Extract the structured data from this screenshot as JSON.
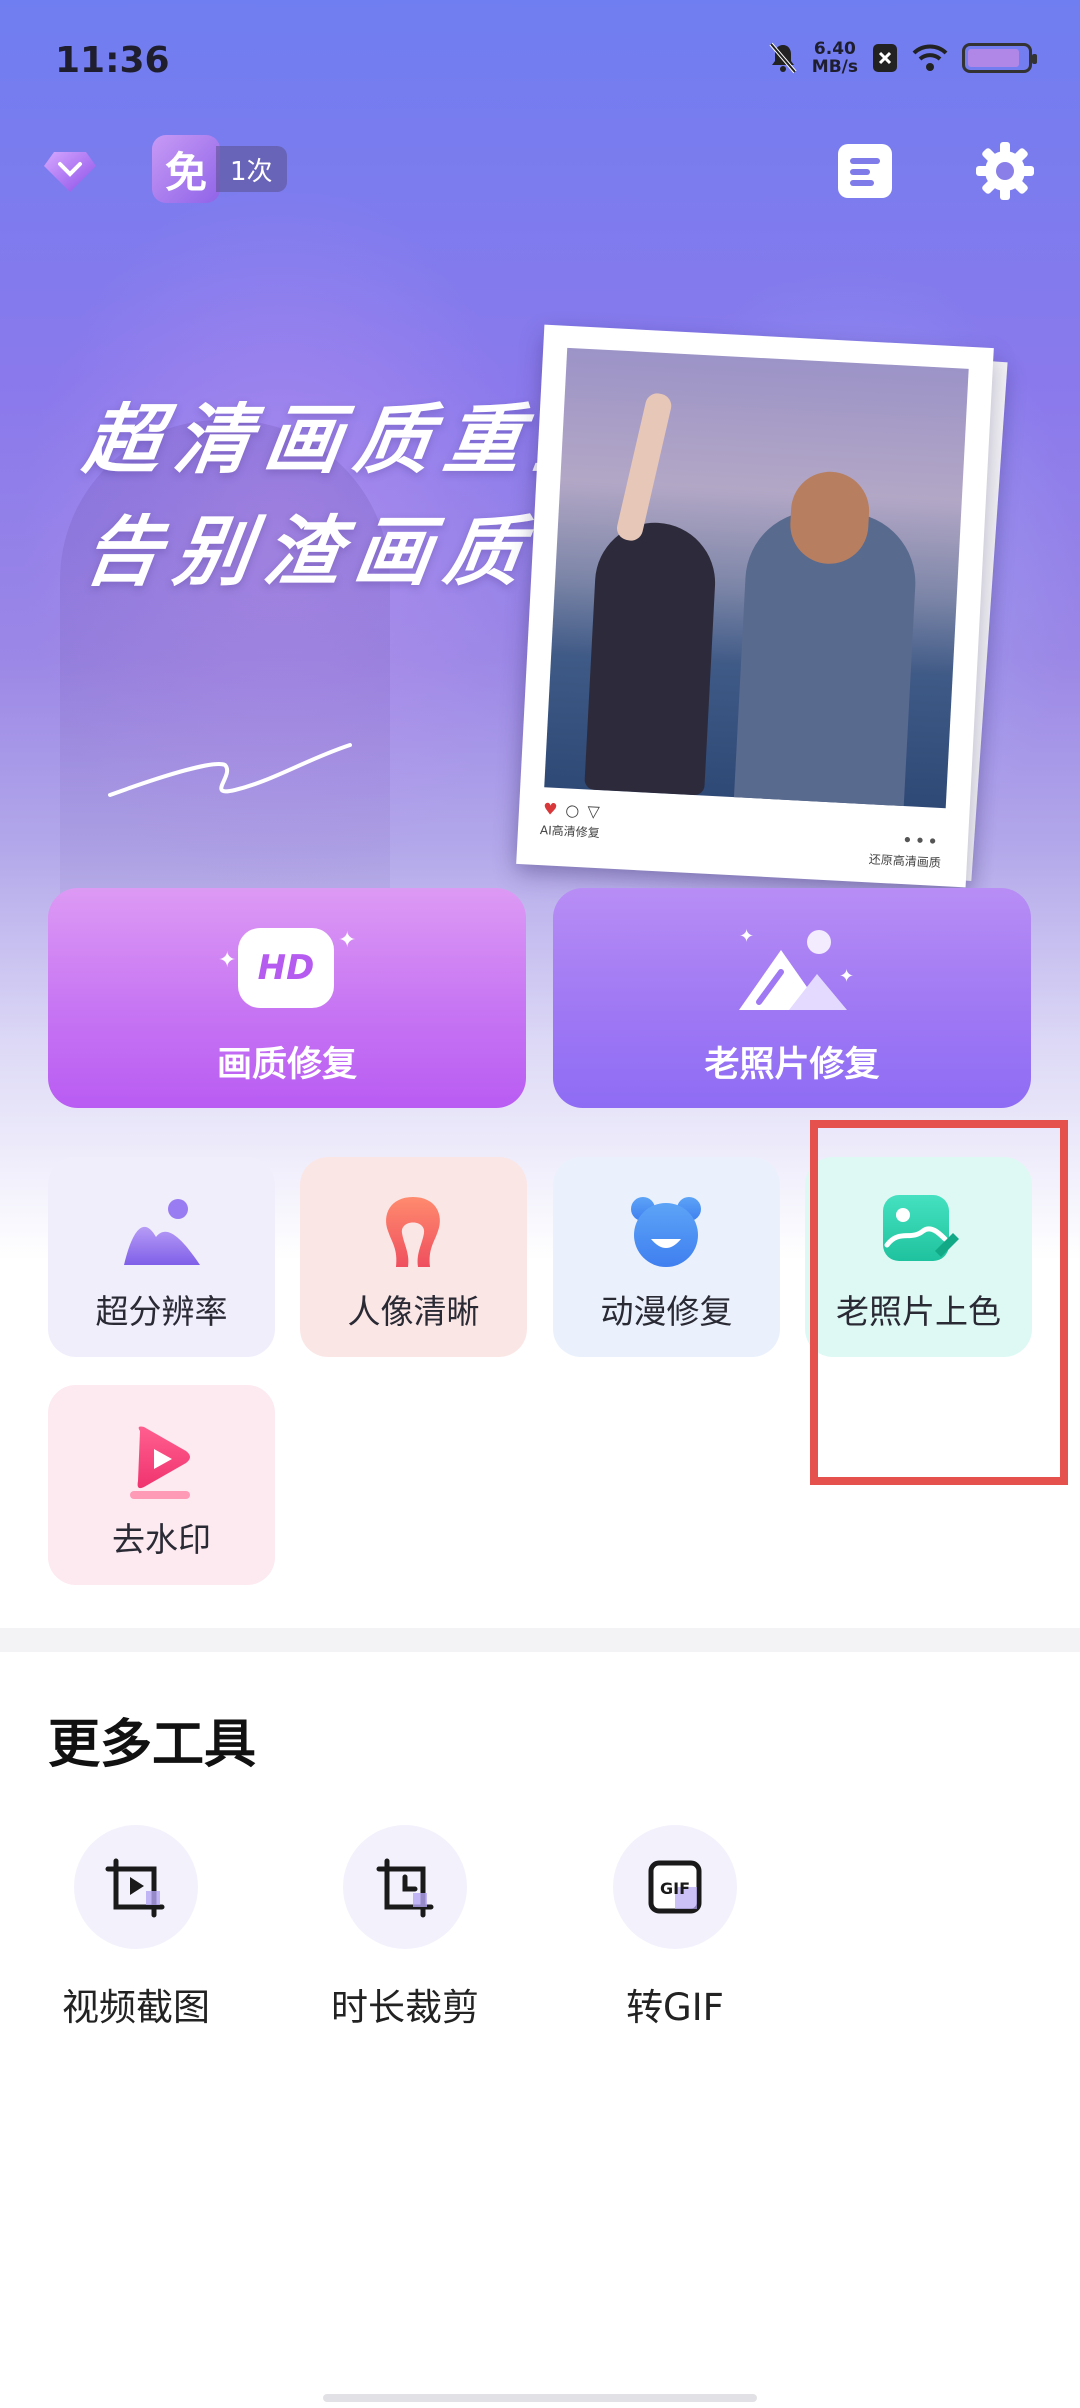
{
  "status_bar": {
    "time": "11:36",
    "speed_value": "6.40",
    "speed_unit": "MB/s",
    "icons": [
      "bell-muted-icon",
      "sim-x-icon",
      "wifi-icon",
      "battery-icon"
    ]
  },
  "top_bar": {
    "vip_icon": "diamond-vip-icon",
    "free_badge_char": "免",
    "free_count": "1次",
    "doc_icon": "document-icon",
    "settings_icon": "gear-icon"
  },
  "banner": {
    "slogan_line1": "超清画质重生",
    "slogan_line2": "告别渣画质",
    "polaroid_caption_left": "AI高清修复",
    "polaroid_caption_right": "还原高清画质",
    "polaroid_dots": "•••"
  },
  "main_features": [
    {
      "label": "画质修复",
      "icon": "hd-icon",
      "icon_text": "HD"
    },
    {
      "label": "老照片修复",
      "icon": "mountain-photo-icon"
    }
  ],
  "tools_grid": [
    {
      "label": "超分辨率",
      "icon": "super-resolution-icon"
    },
    {
      "label": "人像清晰",
      "icon": "portrait-icon"
    },
    {
      "label": "动漫修复",
      "icon": "anime-bear-icon"
    },
    {
      "label": "老照片上色",
      "icon": "colorize-photo-icon"
    },
    {
      "label": "去水印",
      "icon": "watermark-remove-icon"
    }
  ],
  "more_tools": {
    "title": "更多工具",
    "items": [
      {
        "label": "视频截图",
        "icon": "video-crop-icon"
      },
      {
        "label": "时长裁剪",
        "icon": "duration-trim-icon"
      },
      {
        "label": "转GIF",
        "icon": "gif-icon",
        "icon_text": "GIF"
      }
    ]
  },
  "colors": {
    "accent_purple": "#b95cf3",
    "accent_violet": "#8e6cf4",
    "highlight_red": "#e5524e"
  }
}
